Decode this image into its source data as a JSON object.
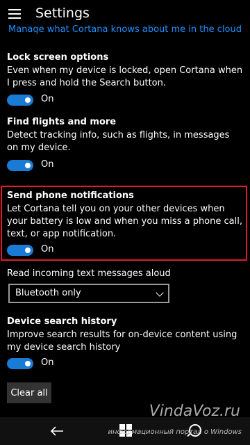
{
  "header": {
    "title": "Settings"
  },
  "cut_link": "Manage what Cortana knows about me in the cloud",
  "sections": [
    {
      "title": "Lock screen options",
      "desc": "Even when my device is locked, open Cortana when I press and hold the Search button.",
      "toggle": "On"
    },
    {
      "title": "Find flights and more",
      "desc": "Detect tracking info, such as flights, in messages on my device.",
      "toggle": "On"
    },
    {
      "title": "Send phone notifications",
      "desc": "Let Cortana tell you on your other devices when your battery is low and when you miss a phone call, text, or app notification.",
      "toggle": "On"
    }
  ],
  "read_aloud": {
    "label": "Read incoming text messages aloud",
    "value": "Bluetooth only"
  },
  "history": {
    "title": "Device search history",
    "desc": "Improve search results for on-device content using my device search history",
    "toggle": "On"
  },
  "clear_button": "Clear all",
  "watermark": {
    "site": "VindaVoz.ru",
    "caption": "информационный портал о Windows"
  },
  "colors": {
    "accent": "#1a7bd4",
    "highlight_border": "#e01b2c",
    "link": "#1e90ff"
  }
}
